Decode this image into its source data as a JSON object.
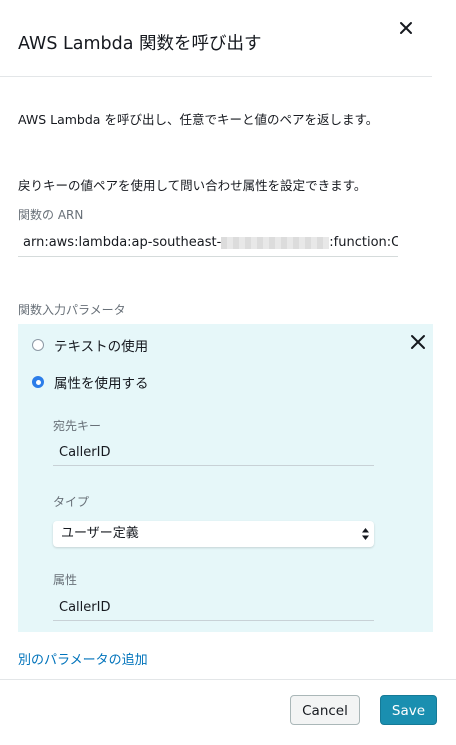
{
  "dialog": {
    "title": "AWS Lambda 関数を呼び出す",
    "close_icon": "close-icon"
  },
  "description": {
    "line1": "AWS Lambda を呼び出し、任意でキーと値のペアを返します。",
    "line2": "戻りキーの値ペアを使用して問い合わせ属性を設定できます。"
  },
  "arn": {
    "label": "関数の ARN",
    "value_prefix": "arn:aws:lambda:ap-southeast-",
    "value_suffix": ":function:Cu"
  },
  "parameters": {
    "section_label": "関数入力パラメータ",
    "remove_icon": "close-icon",
    "options": [
      {
        "label": "テキストの使用",
        "selected": false
      },
      {
        "label": "属性を使用する",
        "selected": true
      }
    ],
    "destination_key": {
      "label": "宛先キー",
      "value": "CallerID"
    },
    "type": {
      "label": "タイプ",
      "selected": "ユーザー定義"
    },
    "attribute": {
      "label": "属性",
      "value": "CallerID"
    },
    "add_link": "別のパラメータの追加"
  },
  "footer": {
    "cancel_label": "Cancel",
    "save_label": "Save"
  },
  "colors": {
    "accent": "#1a8fb0",
    "link": "#0073bb",
    "param_bg": "#e6f7f9",
    "radio_selected": "#2b7de9"
  }
}
